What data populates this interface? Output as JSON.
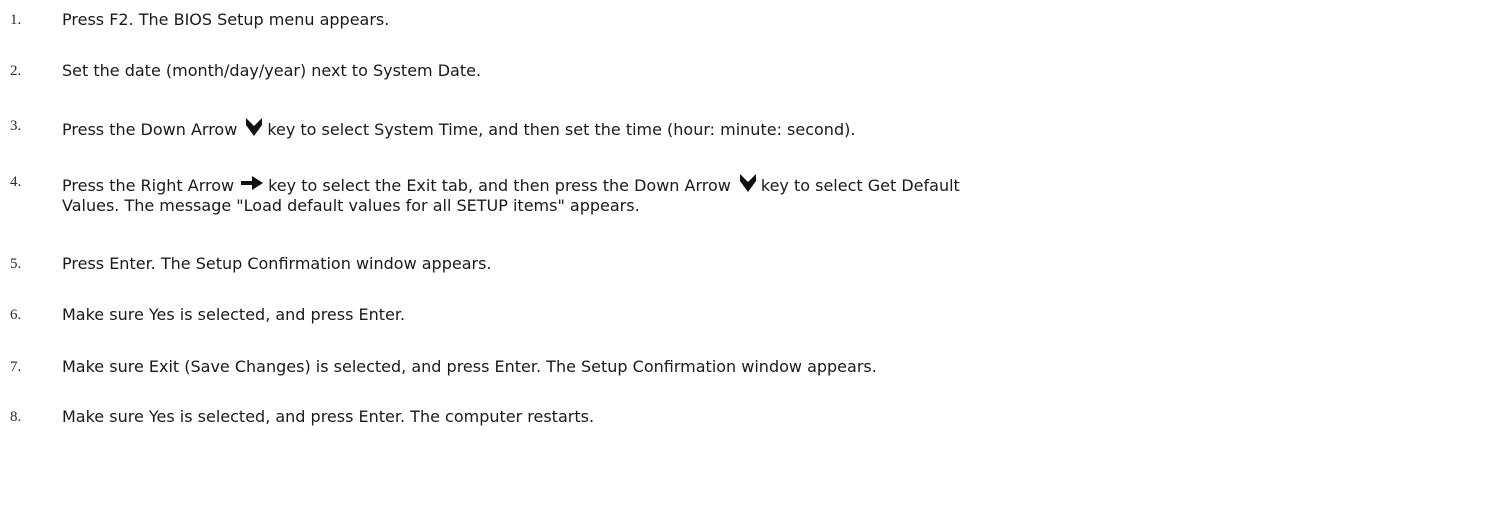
{
  "steps": [
    {
      "num": "1.",
      "text": "Press F2. The BIOS Setup menu appears."
    },
    {
      "num": "2.",
      "text": "Set the date (month/day/year) next to System Date."
    },
    {
      "num": "3.",
      "pre": "Press the Down Arrow",
      "post": "key to select System Time, and then set the time (hour: minute: second)."
    },
    {
      "num": "4.",
      "pre": "Press the Right Arrow",
      "mid": "key to select the Exit tab, and then press the Down Arrow",
      "post": "key to select Get Default",
      "line2": "Values. The message \"Load default values for all SETUP items\" appears."
    },
    {
      "num": "5.",
      "text": "Press Enter. The Setup Confirmation window appears."
    },
    {
      "num": "6.",
      "text": "Make sure Yes is selected, and press Enter."
    },
    {
      "num": "7.",
      "text": "Make sure Exit (Save Changes) is selected, and press Enter. The Setup Confirmation window appears."
    },
    {
      "num": "8.",
      "text": "Make sure Yes is selected, and press Enter. The computer restarts."
    }
  ],
  "icons": {
    "down_arrow": "down-arrow-key-icon",
    "right_arrow": "right-arrow-key-icon"
  }
}
